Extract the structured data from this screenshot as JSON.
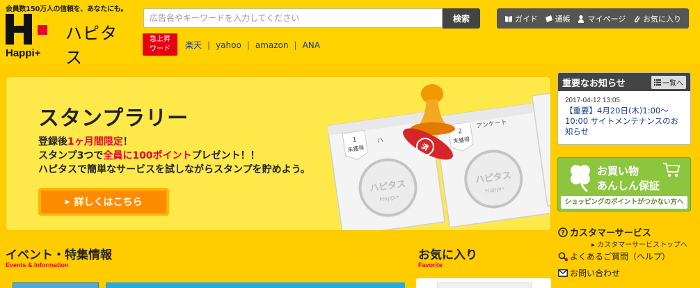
{
  "header": {
    "tagline": "会員数150万人の信頼を、あなたにも。",
    "logo_en": "Happi+",
    "logo_ja": "ハピタス"
  },
  "search": {
    "placeholder": "広告名やキーワードを入力してください",
    "button_label": "検索"
  },
  "trending": {
    "badge_line1": "急上昇",
    "badge_line2": "ワード",
    "links": [
      "楽天",
      "yahoo",
      "amazon",
      "ANA"
    ],
    "separator": "|"
  },
  "topnav": [
    {
      "label": "ガイド",
      "icon": "book-icon"
    },
    {
      "label": "通帳",
      "icon": "passbook-icon"
    },
    {
      "label": "マイページ",
      "icon": "person-icon"
    },
    {
      "label": "お気に入り",
      "icon": "clip-icon"
    }
  ],
  "banner": {
    "title": "スタンプラリー",
    "line1_pre": "登録後",
    "line1_hl": "1ヶ月間限定",
    "line1_post": "！",
    "line2_pre": "スタンプ3つで",
    "line2_hl": "全員に100ポイント",
    "line2_post": "プレゼント！！",
    "line3": "ハピタスで簡単なサービスを試しながらスタンプを貯めよう。",
    "cta": "詳しくはこちら",
    "cta_arrow": "▸",
    "card1_num": "1",
    "card1_status": "未獲得",
    "card1_label": "ハ",
    "card2_num": "2",
    "card2_label": "アンケート",
    "card2_status": "未獲得",
    "stamp_text": "ハピタス",
    "stamp_sub": "Happi+",
    "seal_text": "済"
  },
  "notice": {
    "title": "重要なお知らせ",
    "more": "一覧へ",
    "date": "2017-04-12 13:05",
    "text": "【重要】4月20日(木)1:00～10:00 サイトメンテナンスのお知らせ"
  },
  "safe": {
    "line1": "お買い物",
    "line2": "あんしん保証",
    "sub": "ショッピングのポイントがつかない方へ"
  },
  "support": {
    "cs_title": "カスタマーサービス",
    "cs_sub": "カスタマーサービストップへ",
    "faq": "よくあるご質問（ヘルプ）",
    "contact": "お問い合わせ"
  },
  "sections": {
    "events_title": "イベント・特集情報",
    "events_sub": "Events & Information",
    "fav_title": "お気に入り",
    "fav_sub": "Favorite"
  },
  "colors": {
    "background": "#ffcc00",
    "accent_red": "#e60033",
    "cta_orange": "#ff8c00",
    "nav_dark": "#555555",
    "safe_green": "#8cc63f"
  }
}
